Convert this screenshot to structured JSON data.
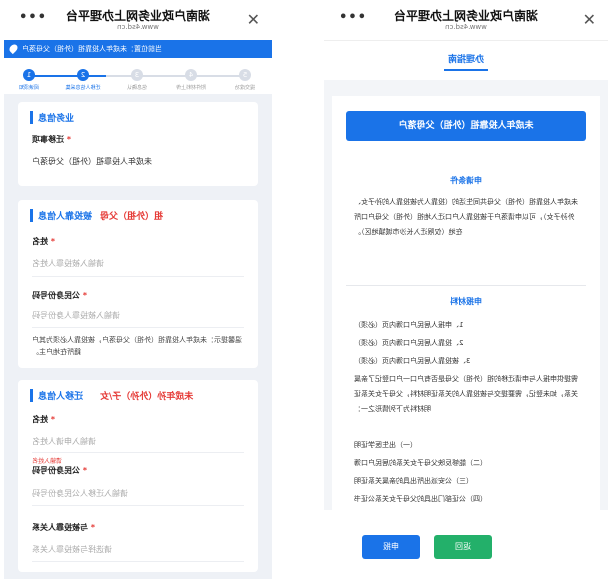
{
  "form_panel": {
    "header": {
      "title": "湖南户政业务网上办理平台",
      "subtitle": "www.4sd.cn",
      "more_label": "•••",
      "close_label": "✕"
    },
    "location": "当前位置：未成年人投靠祖（外祖）父母落户",
    "steps": [
      {
        "num": "1",
        "label": "阅读须知"
      },
      {
        "num": "2",
        "label": "迁移人信息采集"
      },
      {
        "num": "3",
        "label": "信息确认"
      },
      {
        "num": "4",
        "label": "附件材料上传"
      },
      {
        "num": "5",
        "label": "提交成功"
      }
    ],
    "business": {
      "title": "业务信息",
      "field_label": "迁移事项",
      "field_value": "未成年人投靠祖（外祖）父母落户"
    },
    "relative": {
      "title": "被投靠人信息",
      "title_red": "祖（外祖）父母",
      "name_label": "姓名",
      "name_placeholder": "请输入被投靠人姓名",
      "id_label": "公民身份号码",
      "id_placeholder": "请输入被投靠人身份号码",
      "note": "温馨提示：未成年人投靠祖（外祖）父母落户，被投靠人必须为其户籍所在地户主。"
    },
    "migrant": {
      "title": "迁移人信息",
      "title_red": "未成年孙（外孙）子/女",
      "name_label": "姓名",
      "name_placeholder": "请输入申请人姓名",
      "error": "请输入姓名",
      "id_label": "公民身份号码",
      "id_placeholder": "请输入迁移人公民身份号码",
      "rel_label": "与被投靠人关系",
      "rel_placeholder": "请选择与被投靠人关系"
    }
  },
  "guide_panel": {
    "header": {
      "title": "湖南户政业务网上办理平台",
      "subtitle": "www.4sd.cn",
      "more_label": "•••",
      "close_label": "✕"
    },
    "tab": "办理指南",
    "banner": "未成年人投靠祖（外祖）父母落户",
    "conditions_title": "申请条件",
    "conditions_text": "未成年人投靠祖（外祖）父母共同生活的（投靠人为被投靠人的孙子女、外孙子女），可以申请落户于被投靠人户口迁入地祖（外祖）父母户口所在地（仅限迁入长沙市城镇地区）。",
    "materials_title": "申报材料",
    "materials": [
      "1、申报人居民户口簿内页（必须）",
      "2、投靠人居民户口簿内页（必须）",
      "3、被投靠人居民户口簿内页（必须）",
      "需提供申报人与申请迁移的祖（外祖）父母是否有户口一户口登记了亲属关系，如未登记，需要提交与被投靠人的关系证明材料，父母子女关系证明材料为下列情形之一：",
      "（一）出生医学证明",
      "（二）能够反映父母子女关系的居民户口簿",
      "（三）公安派出所出具的亲属关系证明",
      "（四）公证部门出具的父母子女关系公证书"
    ],
    "apply_button": "申报",
    "back_button": "返回"
  },
  "colors": {
    "primary": "#1a73e8",
    "green": "#23b06a",
    "red": "#e53935"
  }
}
